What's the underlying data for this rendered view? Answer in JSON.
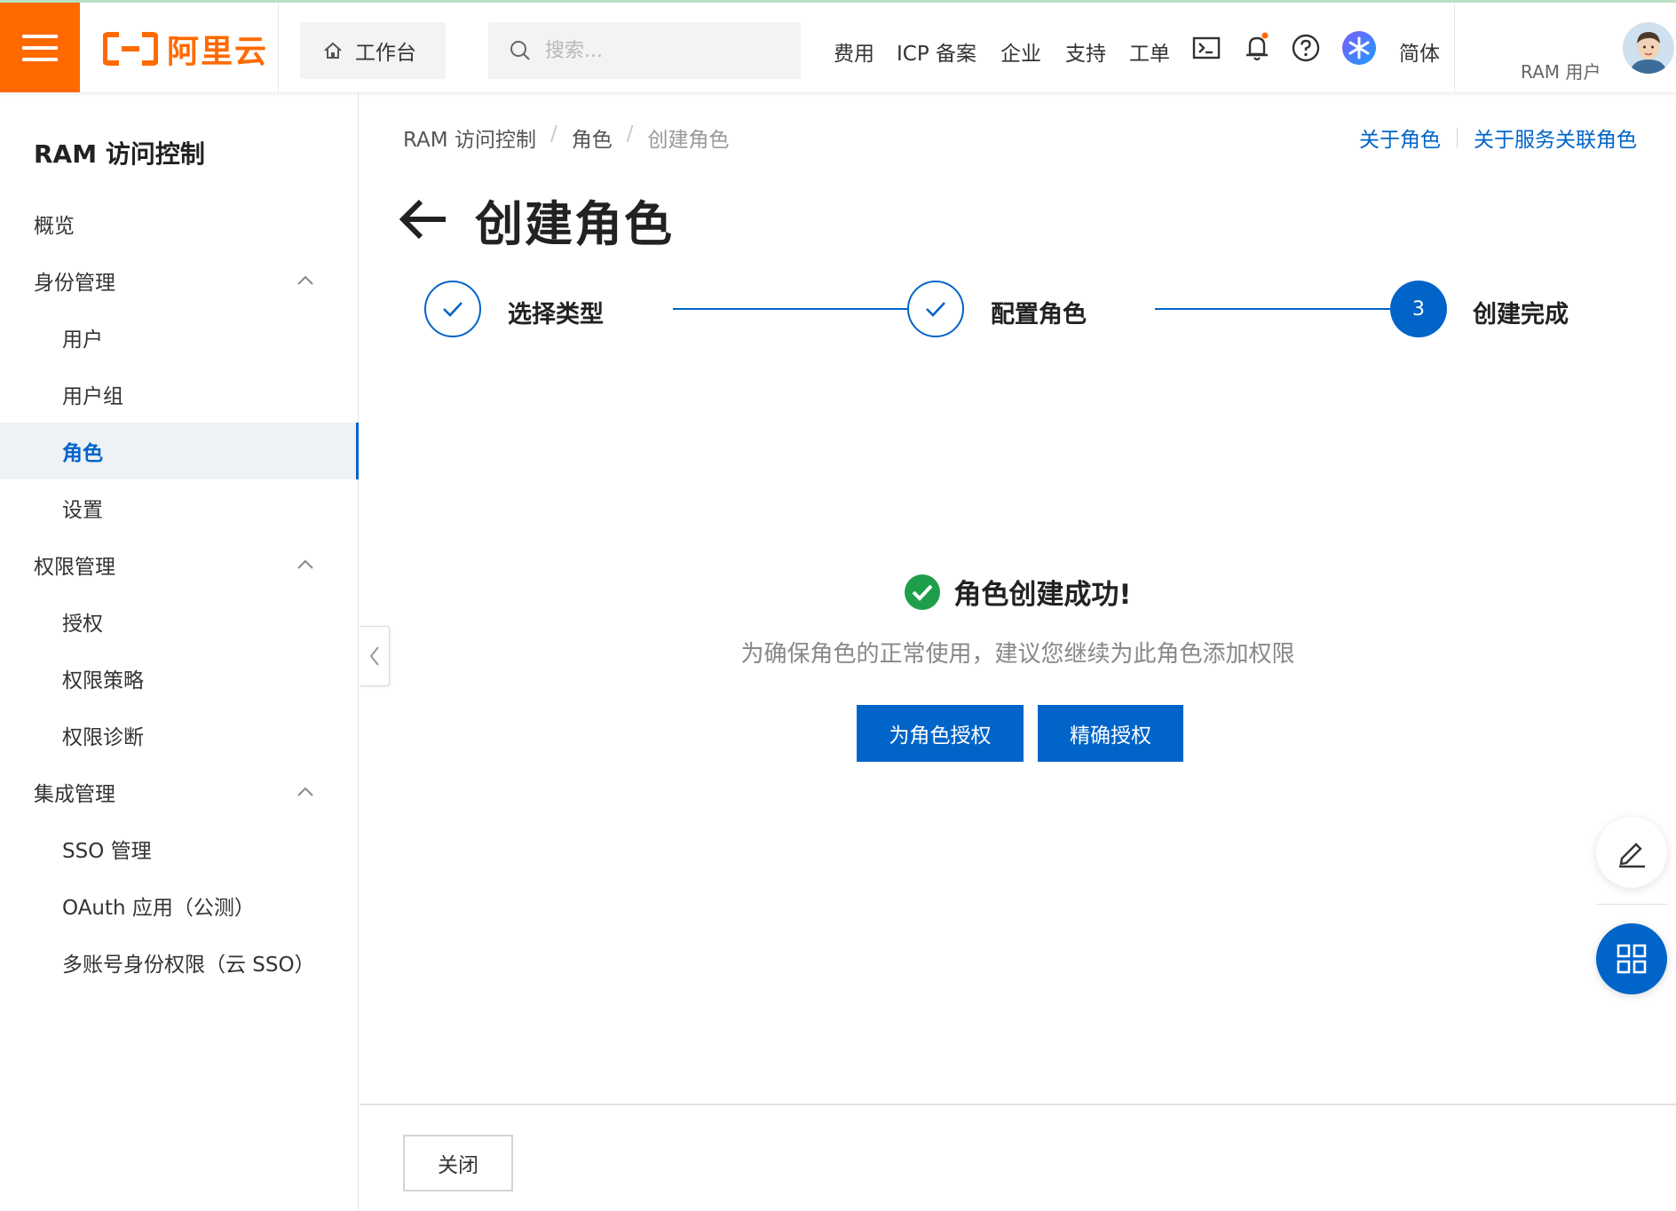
{
  "brand": {
    "name": "阿里云",
    "color": "#ff6a00"
  },
  "accent_color": "#0064c8",
  "header": {
    "workbench_label": "工作台",
    "search_placeholder": "搜索...",
    "nav": [
      "费用",
      "ICP 备案",
      "企业",
      "支持",
      "工单"
    ],
    "language": "简体",
    "user_label": "RAM 用户",
    "icons": [
      "menu-icon",
      "home-icon",
      "search-icon",
      "terminal-icon",
      "bell-icon",
      "help-icon",
      "assistant-icon"
    ]
  },
  "sidebar": {
    "title": "RAM 访问控制",
    "items": [
      {
        "label": "概览",
        "level": 1
      },
      {
        "label": "身份管理",
        "level": 1,
        "expanded": true
      },
      {
        "label": "用户",
        "level": 2
      },
      {
        "label": "用户组",
        "level": 2
      },
      {
        "label": "角色",
        "level": 2,
        "active": true
      },
      {
        "label": "设置",
        "level": 2
      },
      {
        "label": "权限管理",
        "level": 1,
        "expanded": true
      },
      {
        "label": "授权",
        "level": 2
      },
      {
        "label": "权限策略",
        "level": 2
      },
      {
        "label": "权限诊断",
        "level": 2
      },
      {
        "label": "集成管理",
        "level": 1,
        "expanded": true
      },
      {
        "label": "SSO 管理",
        "level": 2
      },
      {
        "label": "OAuth 应用（公测）",
        "level": 2
      },
      {
        "label": "多账号身份权限（云 SSO）",
        "level": 2
      }
    ]
  },
  "breadcrumb": [
    "RAM 访问控制",
    "角色",
    "创建角色"
  ],
  "help_links": [
    "关于角色",
    "关于服务关联角色"
  ],
  "page_title": "创建角色",
  "steps": [
    {
      "label": "选择类型",
      "status": "done"
    },
    {
      "label": "配置角色",
      "status": "done"
    },
    {
      "label": "创建完成",
      "status": "current",
      "number": "3"
    }
  ],
  "result": {
    "title": "角色创建成功!",
    "description": "为确保角色的正常使用，建议您继续为此角色添加权限",
    "actions": [
      "为角色授权",
      "精确授权"
    ]
  },
  "footer": {
    "close_label": "关闭"
  }
}
